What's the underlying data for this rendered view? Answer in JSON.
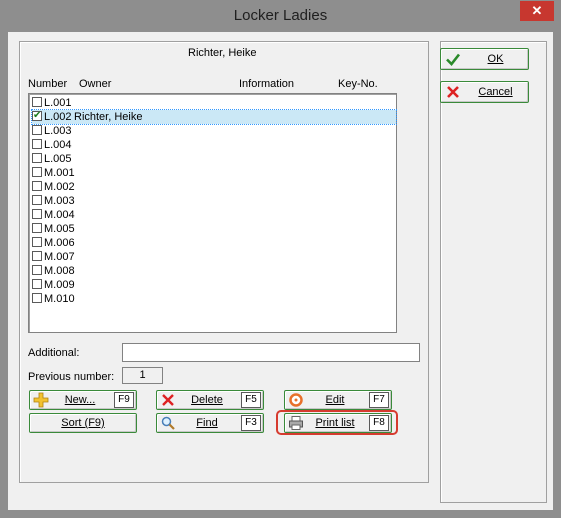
{
  "window": {
    "title": "Locker Ladies",
    "close_label": "✕"
  },
  "header": {
    "owner_name": "Richter, Heike"
  },
  "columns": {
    "number": "Number",
    "owner": "Owner",
    "information": "Information",
    "key_no": "Key-No."
  },
  "lockers": [
    {
      "number": "L.001",
      "owner": "",
      "checked": false,
      "selected": false
    },
    {
      "number": "L.002",
      "owner": "Richter, Heike",
      "checked": true,
      "selected": true
    },
    {
      "number": "L.003",
      "owner": "",
      "checked": false,
      "selected": false
    },
    {
      "number": "L.004",
      "owner": "",
      "checked": false,
      "selected": false
    },
    {
      "number": "L.005",
      "owner": "",
      "checked": false,
      "selected": false
    },
    {
      "number": "M.001",
      "owner": "",
      "checked": false,
      "selected": false
    },
    {
      "number": "M.002",
      "owner": "",
      "checked": false,
      "selected": false
    },
    {
      "number": "M.003",
      "owner": "",
      "checked": false,
      "selected": false
    },
    {
      "number": "M.004",
      "owner": "",
      "checked": false,
      "selected": false
    },
    {
      "number": "M.005",
      "owner": "",
      "checked": false,
      "selected": false
    },
    {
      "number": "M.006",
      "owner": "",
      "checked": false,
      "selected": false
    },
    {
      "number": "M.007",
      "owner": "",
      "checked": false,
      "selected": false
    },
    {
      "number": "M.008",
      "owner": "",
      "checked": false,
      "selected": false
    },
    {
      "number": "M.009",
      "owner": "",
      "checked": false,
      "selected": false
    },
    {
      "number": "M.010",
      "owner": "",
      "checked": false,
      "selected": false
    }
  ],
  "fields": {
    "additional_label": "Additional:",
    "additional_value": "",
    "previous_number_label": "Previous number:",
    "previous_number_value": "1"
  },
  "buttons": {
    "new": {
      "label": "New...",
      "key": "F9",
      "icon": "plus-icon"
    },
    "delete": {
      "label": "Delete",
      "key": "F5",
      "icon": "red-x-icon"
    },
    "edit": {
      "label": "Edit",
      "key": "F7",
      "icon": "edit-icon"
    },
    "sort": {
      "label": "Sort (F9)"
    },
    "find": {
      "label": "Find",
      "key": "F3",
      "icon": "magnifier-icon"
    },
    "print_list": {
      "label": "Print list",
      "key": "F8",
      "icon": "printer-icon"
    },
    "ok": {
      "label": "OK",
      "icon": "checkmark-icon"
    },
    "cancel": {
      "label": "Cancel",
      "icon": "red-x-icon"
    }
  },
  "colors": {
    "highlight": "#d63b2f",
    "button_border": "#3a8a3a",
    "close": "#c7372f"
  }
}
